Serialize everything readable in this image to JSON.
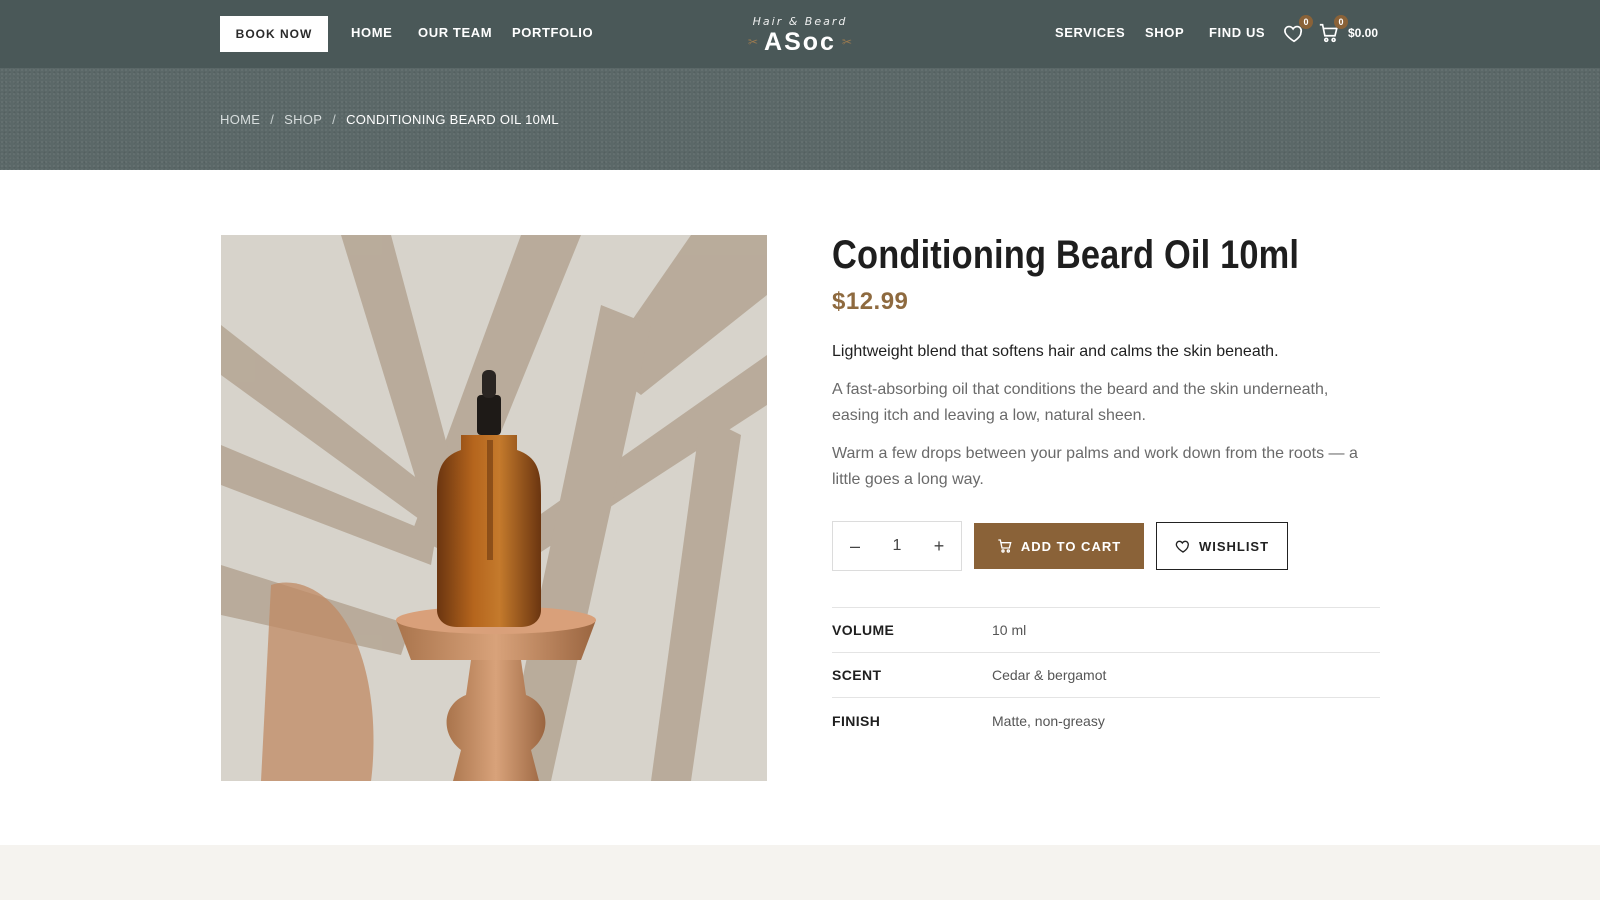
{
  "header": {
    "book_now": "BOOK NOW",
    "nav_left": [
      "HOME",
      "OUR TEAM",
      "PORTFOLIO"
    ],
    "nav_right": [
      "SERVICES",
      "SHOP",
      "FIND US"
    ],
    "logo": {
      "tagline": "Hair & Beard",
      "name": "ASoc"
    },
    "wishlist_count": "0",
    "cart_count": "0",
    "cart_total": "$0.00",
    "icons": {
      "wishlist": "heart-icon",
      "cart": "cart-icon"
    }
  },
  "breadcrumb": {
    "items": [
      "HOME",
      "SHOP"
    ],
    "separator": "/",
    "current": "CONDITIONING BEARD OIL 10ML"
  },
  "product": {
    "title": "Conditioning Beard Oil 10ml",
    "price": "$12.99",
    "lead": "Lightweight blend that softens hair and calms the skin beneath.",
    "description": [
      "A fast-absorbing oil that conditions the beard and the skin underneath, easing itch and leaving a low, natural sheen.",
      "Warm a few drops between your palms and work down from the roots — a little goes a long way."
    ],
    "quantity": {
      "minus": "–",
      "value": "1",
      "plus": "+"
    },
    "add_to_cart": "ADD TO CART",
    "wishlist": "WISHLIST",
    "specs": [
      {
        "key": "VOLUME",
        "value": "10 ml"
      },
      {
        "key": "SCENT",
        "value": "Cedar & bergamot"
      },
      {
        "key": "FINISH",
        "value": "Matte, non-greasy"
      }
    ]
  },
  "colors": {
    "header_bg": "#4a5858",
    "accent": "#8a6238",
    "price": "#8e6a3f",
    "footer_bg": "#f5f3ef"
  }
}
